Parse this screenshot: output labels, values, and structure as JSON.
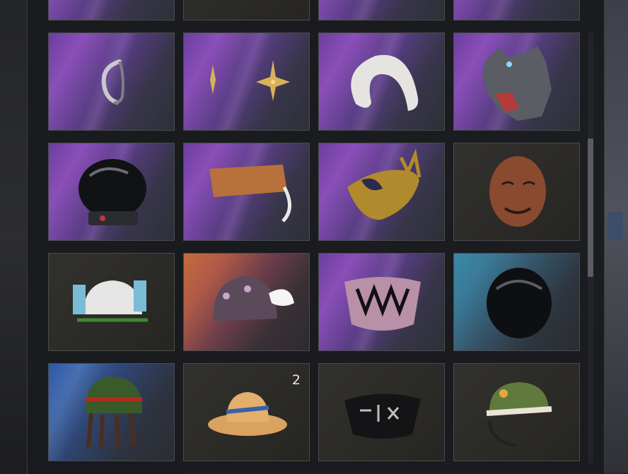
{
  "inventory": {
    "items": [
      {
        "icon": "cat-ears-headband-icon"
      },
      {
        "icon": "star-earrings-icon"
      },
      {
        "icon": "white-fur-headband-icon"
      },
      {
        "icon": "wolf-mask-icon"
      },
      {
        "icon": "black-space-helmet-icon"
      },
      {
        "icon": "orange-visor-headset-icon"
      },
      {
        "icon": "gold-spiked-masquerade-mask-icon"
      },
      {
        "icon": "hahoe-wooden-mask-icon"
      },
      {
        "icon": "drink-helmet-icon"
      },
      {
        "icon": "winged-star-beanie-icon"
      },
      {
        "icon": "fanged-face-mask-icon"
      },
      {
        "icon": "black-motorcycle-helmet-icon"
      },
      {
        "icon": "rasta-dreadlock-cap-icon"
      },
      {
        "icon": "straw-sun-hat-icon",
        "quantity": "2"
      },
      {
        "icon": "black-logo-face-mask-icon"
      },
      {
        "icon": "bucket-hat-headset-icon"
      }
    ]
  },
  "colors": {
    "purple_rarity": "#7a48aa",
    "blue_rarity": "#355ea3",
    "plain_rarity": "#2d2c29",
    "orange_rarity": "#c46b3c",
    "cyan_rarity": "#3a7a98"
  }
}
